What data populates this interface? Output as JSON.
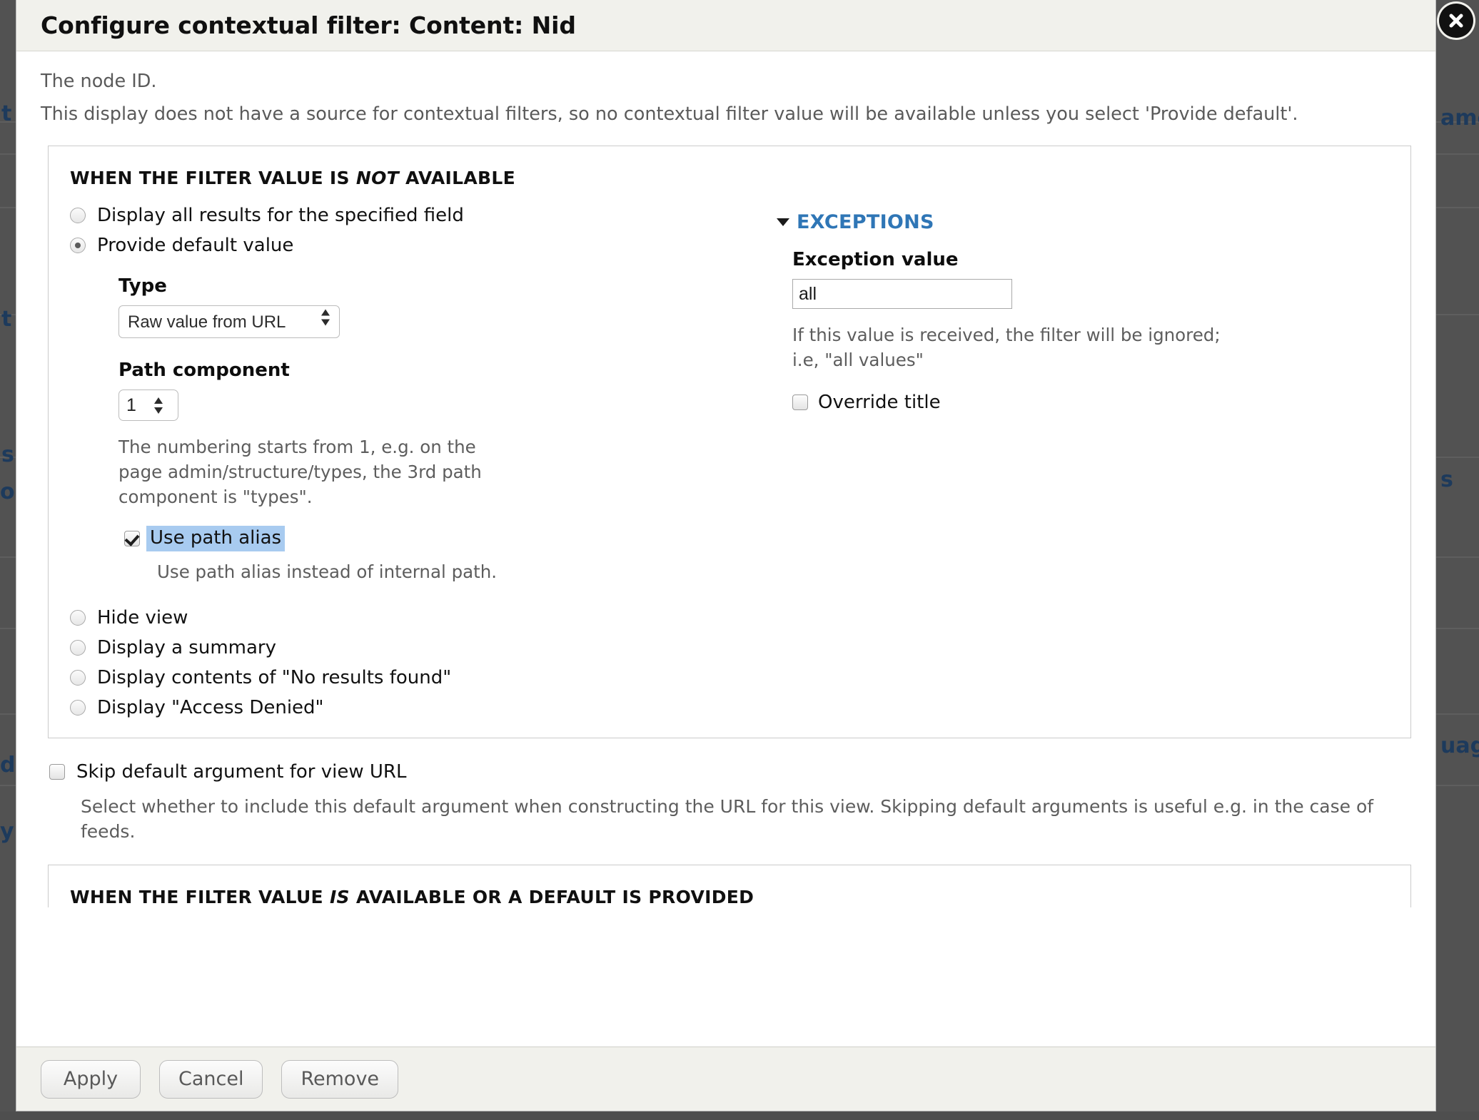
{
  "dialog": {
    "title": "Configure contextual filter: Content: Nid",
    "close_icon": "close-circle-icon",
    "description_line1": "The node ID.",
    "description_line2": "This display does not have a source for contextual filters, so no contextual filter value will be available unless you select 'Provide default'."
  },
  "not_available_section": {
    "legend_before": "WHEN THE FILTER VALUE IS ",
    "legend_emphasis": "NOT",
    "legend_after": " AVAILABLE",
    "options": [
      {
        "label": "Display all results for the specified field",
        "selected": false
      },
      {
        "label": "Provide default value",
        "selected": true
      }
    ],
    "trailing_options": [
      {
        "label": "Hide view",
        "selected": false
      },
      {
        "label": "Display a summary",
        "selected": false
      },
      {
        "label": "Display contents of \"No results found\"",
        "selected": false
      },
      {
        "label": "Display \"Access Denied\"",
        "selected": false
      }
    ],
    "type_label": "Type",
    "type_value": "Raw value from URL",
    "type_options": [
      "Raw value from URL"
    ],
    "path_component_label": "Path component",
    "path_component_value": "1",
    "path_component_help": "The numbering starts from 1, e.g. on the page admin/structure/types, the 3rd path component is \"types\".",
    "use_path_alias_label": "Use path alias",
    "use_path_alias_checked": true,
    "use_path_alias_help": "Use path alias instead of internal path."
  },
  "exceptions": {
    "title": "EXCEPTIONS",
    "expanded": true,
    "disclosure_icon": "triangle-down-icon",
    "value_label": "Exception value",
    "value": "all",
    "value_help": "If this value is received, the filter will be ignored; i.e, \"all values\"",
    "override_title_label": "Override title",
    "override_title_checked": false
  },
  "skip_default": {
    "label": "Skip default argument for view URL",
    "checked": false,
    "help": "Select whether to include this default argument when constructing the URL for this view. Skipping default arguments is useful e.g. in the case of feeds."
  },
  "available_section": {
    "legend_before": "WHEN THE FILTER VALUE ",
    "legend_emphasis": "IS",
    "legend_after": " AVAILABLE OR A DEFAULT IS PROVIDED"
  },
  "footer": {
    "apply_label": "Apply",
    "cancel_label": "Cancel",
    "remove_label": "Remove"
  },
  "background": {
    "fragment_name": "ame",
    "fragment_s": "s",
    "fragment_uage": "uage",
    "left_t1": "t",
    "left_t2": "t",
    "left_s": "s",
    "left_o": "o",
    "left_y": "y",
    "left_d": "d",
    "overlay_color": "#525252"
  },
  "colors": {
    "header_bg": "#f1f1ec",
    "accent_blue": "#2f76b6",
    "selection_blue": "#a8cbf0",
    "muted_text": "#5d5d5d"
  }
}
